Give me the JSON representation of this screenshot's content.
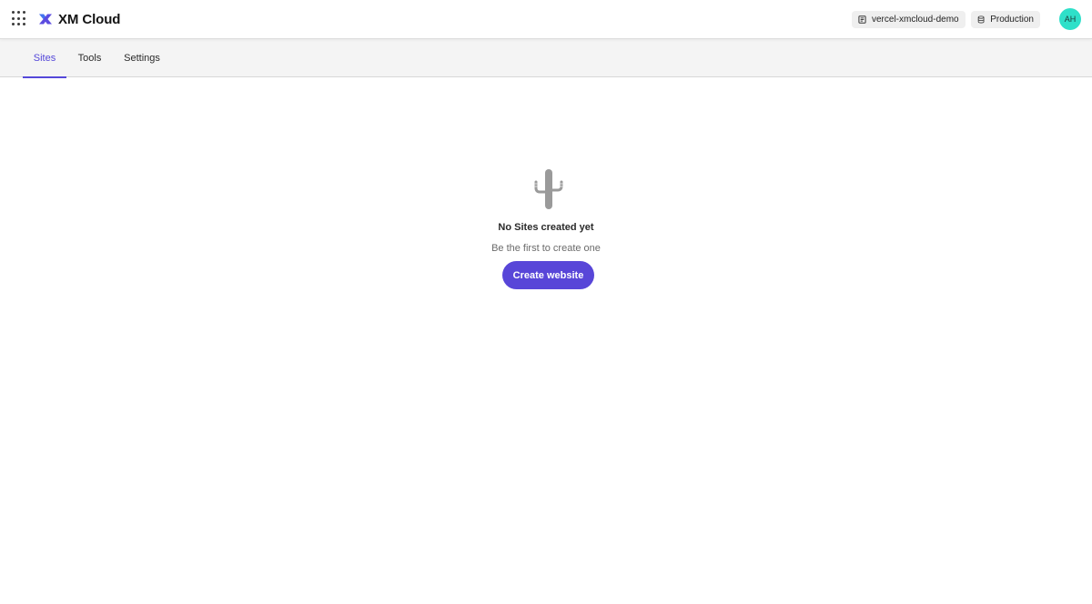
{
  "header": {
    "apps_icon": "grid-dots-icon",
    "brand_icon": "xm-cloud-logo-icon",
    "app_name": "XM Cloud",
    "environment": {
      "icon": "project-icon",
      "label": "vercel-xmcloud-demo"
    },
    "database": {
      "icon": "database-icon",
      "label": "Production"
    },
    "avatar_initials": "AH",
    "avatar_color": "#2ee0c9"
  },
  "tabs": [
    {
      "label": "Sites",
      "active": true
    },
    {
      "label": "Tools",
      "active": false
    },
    {
      "label": "Settings",
      "active": false
    }
  ],
  "empty_state": {
    "icon": "cactus-icon",
    "title": "No Sites created yet",
    "subtitle": "Be the first to create one",
    "button_label": "Create website"
  },
  "colors": {
    "accent": "#5548d9",
    "button": "#5846d8"
  }
}
